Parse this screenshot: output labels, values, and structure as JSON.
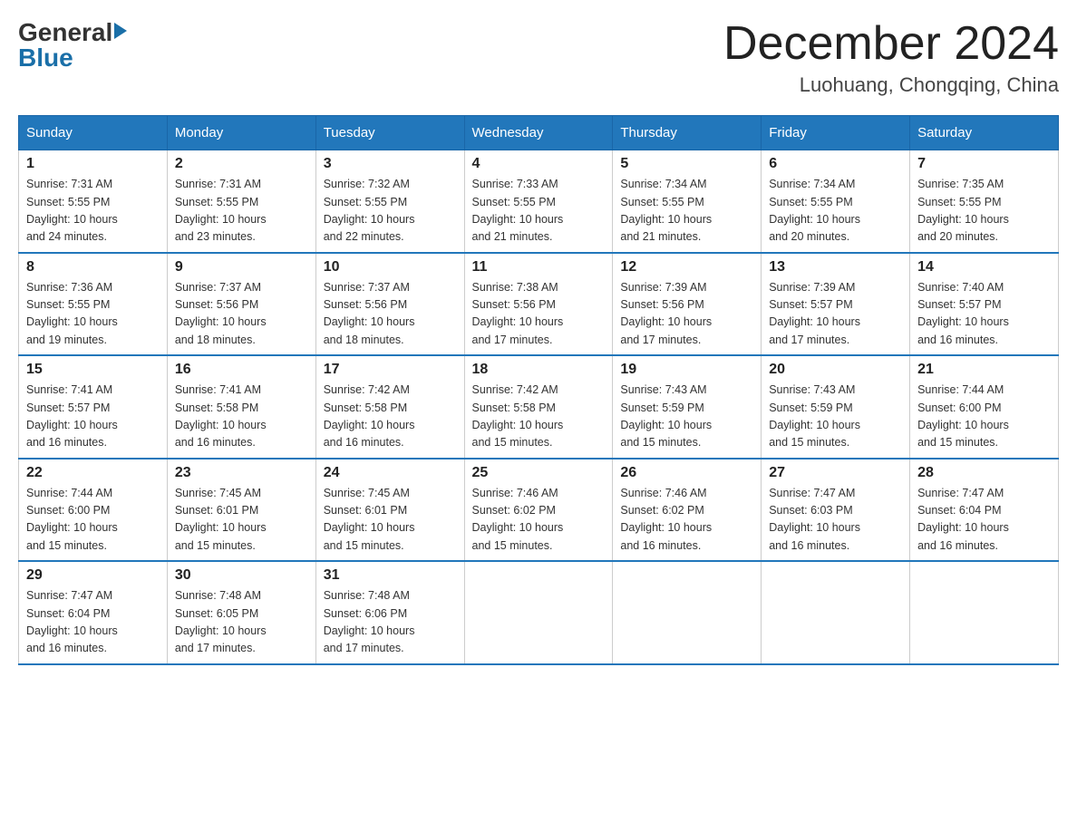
{
  "logo": {
    "general": "General",
    "blue": "Blue"
  },
  "title": "December 2024",
  "location": "Luohuang, Chongqing, China",
  "days_of_week": [
    "Sunday",
    "Monday",
    "Tuesday",
    "Wednesday",
    "Thursday",
    "Friday",
    "Saturday"
  ],
  "weeks": [
    [
      {
        "day": "1",
        "sunrise": "7:31 AM",
        "sunset": "5:55 PM",
        "daylight": "10 hours and 24 minutes."
      },
      {
        "day": "2",
        "sunrise": "7:31 AM",
        "sunset": "5:55 PM",
        "daylight": "10 hours and 23 minutes."
      },
      {
        "day": "3",
        "sunrise": "7:32 AM",
        "sunset": "5:55 PM",
        "daylight": "10 hours and 22 minutes."
      },
      {
        "day": "4",
        "sunrise": "7:33 AM",
        "sunset": "5:55 PM",
        "daylight": "10 hours and 21 minutes."
      },
      {
        "day": "5",
        "sunrise": "7:34 AM",
        "sunset": "5:55 PM",
        "daylight": "10 hours and 21 minutes."
      },
      {
        "day": "6",
        "sunrise": "7:34 AM",
        "sunset": "5:55 PM",
        "daylight": "10 hours and 20 minutes."
      },
      {
        "day": "7",
        "sunrise": "7:35 AM",
        "sunset": "5:55 PM",
        "daylight": "10 hours and 20 minutes."
      }
    ],
    [
      {
        "day": "8",
        "sunrise": "7:36 AM",
        "sunset": "5:55 PM",
        "daylight": "10 hours and 19 minutes."
      },
      {
        "day": "9",
        "sunrise": "7:37 AM",
        "sunset": "5:56 PM",
        "daylight": "10 hours and 18 minutes."
      },
      {
        "day": "10",
        "sunrise": "7:37 AM",
        "sunset": "5:56 PM",
        "daylight": "10 hours and 18 minutes."
      },
      {
        "day": "11",
        "sunrise": "7:38 AM",
        "sunset": "5:56 PM",
        "daylight": "10 hours and 17 minutes."
      },
      {
        "day": "12",
        "sunrise": "7:39 AM",
        "sunset": "5:56 PM",
        "daylight": "10 hours and 17 minutes."
      },
      {
        "day": "13",
        "sunrise": "7:39 AM",
        "sunset": "5:57 PM",
        "daylight": "10 hours and 17 minutes."
      },
      {
        "day": "14",
        "sunrise": "7:40 AM",
        "sunset": "5:57 PM",
        "daylight": "10 hours and 16 minutes."
      }
    ],
    [
      {
        "day": "15",
        "sunrise": "7:41 AM",
        "sunset": "5:57 PM",
        "daylight": "10 hours and 16 minutes."
      },
      {
        "day": "16",
        "sunrise": "7:41 AM",
        "sunset": "5:58 PM",
        "daylight": "10 hours and 16 minutes."
      },
      {
        "day": "17",
        "sunrise": "7:42 AM",
        "sunset": "5:58 PM",
        "daylight": "10 hours and 16 minutes."
      },
      {
        "day": "18",
        "sunrise": "7:42 AM",
        "sunset": "5:58 PM",
        "daylight": "10 hours and 15 minutes."
      },
      {
        "day": "19",
        "sunrise": "7:43 AM",
        "sunset": "5:59 PM",
        "daylight": "10 hours and 15 minutes."
      },
      {
        "day": "20",
        "sunrise": "7:43 AM",
        "sunset": "5:59 PM",
        "daylight": "10 hours and 15 minutes."
      },
      {
        "day": "21",
        "sunrise": "7:44 AM",
        "sunset": "6:00 PM",
        "daylight": "10 hours and 15 minutes."
      }
    ],
    [
      {
        "day": "22",
        "sunrise": "7:44 AM",
        "sunset": "6:00 PM",
        "daylight": "10 hours and 15 minutes."
      },
      {
        "day": "23",
        "sunrise": "7:45 AM",
        "sunset": "6:01 PM",
        "daylight": "10 hours and 15 minutes."
      },
      {
        "day": "24",
        "sunrise": "7:45 AM",
        "sunset": "6:01 PM",
        "daylight": "10 hours and 15 minutes."
      },
      {
        "day": "25",
        "sunrise": "7:46 AM",
        "sunset": "6:02 PM",
        "daylight": "10 hours and 15 minutes."
      },
      {
        "day": "26",
        "sunrise": "7:46 AM",
        "sunset": "6:02 PM",
        "daylight": "10 hours and 16 minutes."
      },
      {
        "day": "27",
        "sunrise": "7:47 AM",
        "sunset": "6:03 PM",
        "daylight": "10 hours and 16 minutes."
      },
      {
        "day": "28",
        "sunrise": "7:47 AM",
        "sunset": "6:04 PM",
        "daylight": "10 hours and 16 minutes."
      }
    ],
    [
      {
        "day": "29",
        "sunrise": "7:47 AM",
        "sunset": "6:04 PM",
        "daylight": "10 hours and 16 minutes."
      },
      {
        "day": "30",
        "sunrise": "7:48 AM",
        "sunset": "6:05 PM",
        "daylight": "10 hours and 17 minutes."
      },
      {
        "day": "31",
        "sunrise": "7:48 AM",
        "sunset": "6:06 PM",
        "daylight": "10 hours and 17 minutes."
      },
      null,
      null,
      null,
      null
    ]
  ],
  "labels": {
    "sunrise": "Sunrise:",
    "sunset": "Sunset:",
    "daylight": "Daylight:"
  }
}
